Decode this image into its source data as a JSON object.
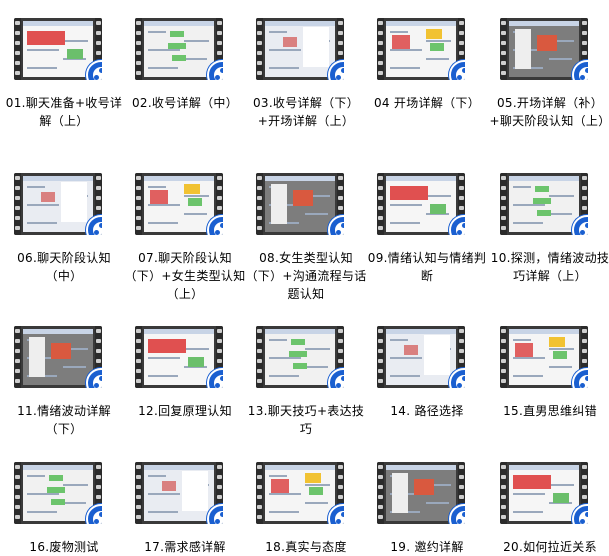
{
  "items": [
    {
      "label": "01.聊天准备+收号详解（上）"
    },
    {
      "label": "02.收号详解（中）"
    },
    {
      "label": "03.收号详解（下）+开场详解（上）"
    },
    {
      "label": "04 开场详解（下）"
    },
    {
      "label": "05.开场详解（补）+聊天阶段认知（上）"
    },
    {
      "label": "06.聊天阶段认知（中）"
    },
    {
      "label": "07.聊天阶段认知（下）+女生类型认知（上）"
    },
    {
      "label": "08.女生类型认知（下）+沟通流程与话题认知"
    },
    {
      "label": "09.情绪认知与情绪判断"
    },
    {
      "label": "10.探测，情绪波动技巧详解（上）"
    },
    {
      "label": "11.情绪波动详解（下）"
    },
    {
      "label": "12.回复原理认知"
    },
    {
      "label": "13.聊天技巧+表达技巧"
    },
    {
      "label": "14. 路径选择"
    },
    {
      "label": "15.直男思维纠错"
    },
    {
      "label": "16.废物测试"
    },
    {
      "label": "17.需求感详解"
    },
    {
      "label": "18.真实与态度"
    },
    {
      "label": "19. 邀约详解"
    },
    {
      "label": "20.如何拉近关系"
    }
  ],
  "colors": {
    "play_badge": "#1a5fd0",
    "film_strip": "#2b2b2b"
  },
  "icons": {
    "thumbnail": "video-thumbnail-icon",
    "badge": "video-reel-icon"
  }
}
